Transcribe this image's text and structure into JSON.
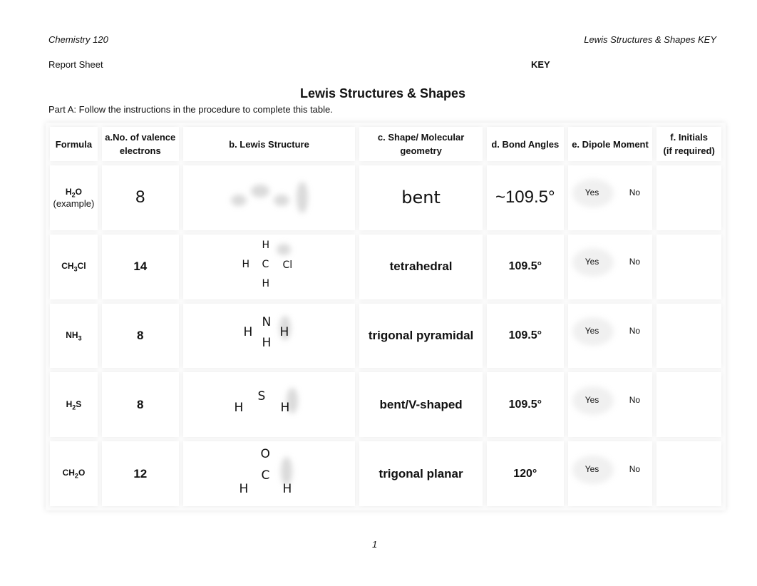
{
  "header": {
    "course": "Chemistry 120",
    "doc_title": "Lewis Structures & Shapes KEY",
    "report_sheet": "Report Sheet",
    "key_label": "KEY"
  },
  "title": "Lewis Structures & Shapes",
  "instruction": "Part A: Follow the instructions in the procedure to complete this table.",
  "table": {
    "columns": [
      {
        "line1": "Formula",
        "line2": ""
      },
      {
        "line1": "a.No. of valence",
        "line2": "electrons"
      },
      {
        "line1": "b.  Lewis Structure",
        "line2": ""
      },
      {
        "line1": "c. Shape/ Molecular",
        "line2": "geometry"
      },
      {
        "line1": "d. Bond Angles",
        "line2": ""
      },
      {
        "line1": "e. Dipole Moment",
        "line2": ""
      },
      {
        "line1": "f. Initials",
        "line2": "(if required)"
      }
    ],
    "rows": [
      {
        "formula_main": "H",
        "formula_sub": "2",
        "formula_tail": "O",
        "note": "(example)",
        "valence": "8",
        "lewis_atoms": [],
        "shape": "bent",
        "angle": "~109.5°",
        "dipole_yes": "Yes",
        "dipole_no": "No",
        "initials": ""
      },
      {
        "formula_main": "CH",
        "formula_sub": "3",
        "formula_tail": "Cl",
        "note": "",
        "valence": "14",
        "lewis_atoms": [
          "H",
          "H",
          "C",
          "Cl",
          "H"
        ],
        "shape": "tetrahedral",
        "angle": "109.5°",
        "dipole_yes": "Yes",
        "dipole_no": "No",
        "initials": ""
      },
      {
        "formula_main": "NH",
        "formula_sub": "3",
        "formula_tail": "",
        "note": "",
        "valence": "8",
        "lewis_atoms": [
          "N",
          "H",
          "H",
          "H"
        ],
        "shape": "trigonal pyramidal",
        "angle": "109.5°",
        "dipole_yes": "Yes",
        "dipole_no": "No",
        "initials": ""
      },
      {
        "formula_main": "H",
        "formula_sub": "2",
        "formula_tail": "S",
        "note": "",
        "valence": "8",
        "lewis_atoms": [
          "S",
          "H",
          "H"
        ],
        "shape": "bent/V-shaped",
        "angle": "109.5°",
        "dipole_yes": "Yes",
        "dipole_no": "No",
        "initials": ""
      },
      {
        "formula_main": "CH",
        "formula_sub": "2",
        "formula_tail": "O",
        "note": "",
        "valence": "12",
        "lewis_atoms": [
          "O",
          "C",
          "H",
          "H"
        ],
        "shape": "trigonal planar",
        "angle": "120°",
        "dipole_yes": "Yes",
        "dipole_no": "No",
        "initials": ""
      }
    ]
  },
  "page_number": "1"
}
